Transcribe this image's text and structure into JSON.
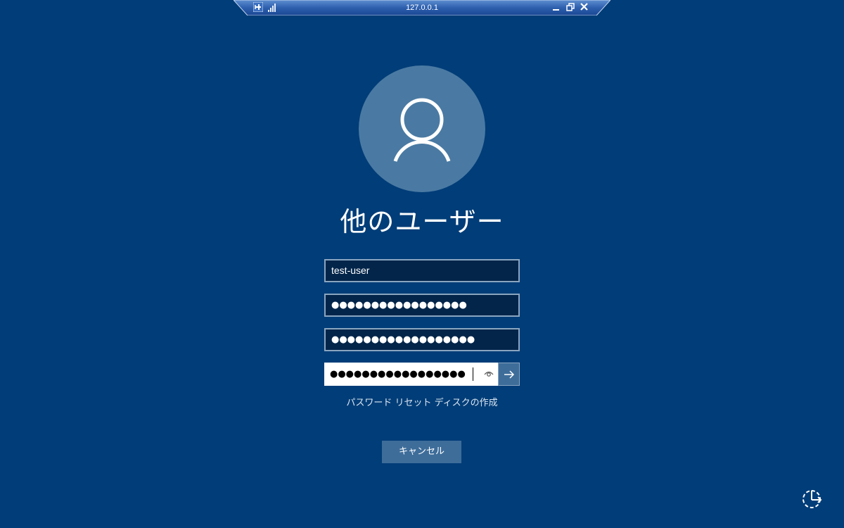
{
  "connection_bar": {
    "host": "127.0.0.1",
    "icons": [
      "pin-icon",
      "signal-icon",
      "minimize-icon",
      "restore-icon",
      "close-icon"
    ]
  },
  "login": {
    "avatar_icon": "user-icon",
    "display_name": "他のユーザー",
    "username_field": {
      "value": "test-user"
    },
    "password_field_1": {
      "masked": "●●●●●●●●●●●●●●●●●"
    },
    "password_field_2": {
      "masked": "●●●●●●●●●●●●●●●●●●"
    },
    "password_field_3": {
      "masked": "●●●●●●●●●●●●●●●●●"
    },
    "reveal_icon": "eye-icon",
    "submit_icon": "arrow-right-icon",
    "reset_link": "パスワード リセット ディスクの作成",
    "cancel_button": "キャンセル"
  },
  "corner": {
    "ease_of_access_icon": "ease-of-access-icon"
  },
  "colors": {
    "background": "#013d78",
    "field_bg": "#03254a",
    "field_border": "#8aa5c0",
    "button_bg": "#3e6d9a",
    "avatar_bg": "#4a7aa3"
  }
}
